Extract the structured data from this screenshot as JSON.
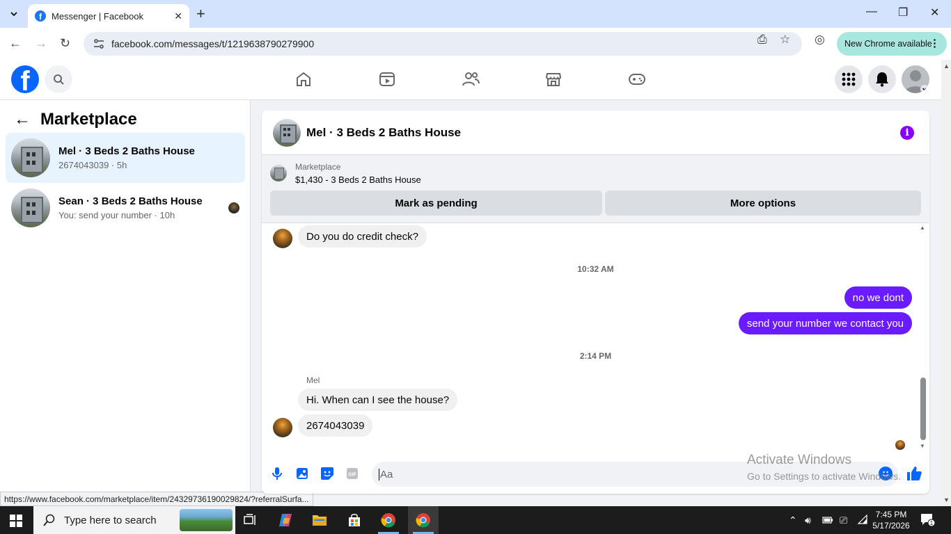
{
  "browser": {
    "tab_title": "Messenger | Facebook",
    "url": "facebook.com/messages/t/1219638790279900",
    "new_chrome_label": "New Chrome available",
    "status_url": "https://www.facebook.com/marketplace/item/24329736190029824/?referralSurfa..."
  },
  "sidebar": {
    "title": "Marketplace",
    "conversations": [
      {
        "name": "Mel · 3 Beds 2 Baths House",
        "subtitle": "2674043039 · 5h",
        "active": true
      },
      {
        "name": "Sean · 3 Beds 2 Baths House",
        "subtitle": "You: send your number · 10h",
        "active": false
      }
    ]
  },
  "chat": {
    "title": "Mel · 3 Beds 2 Baths House",
    "listing": {
      "label": "Marketplace",
      "price_title": "$1,430 - 3 Beds 2 Baths House",
      "mark_pending": "Mark as pending",
      "more_options": "More options"
    },
    "messages": {
      "m1": "Do you do credit check?",
      "time1": "10:32 AM",
      "m2": "no we dont",
      "m3": "send your number we contact you",
      "time2": "2:14 PM",
      "sender": "Mel",
      "m4": "Hi. When can I see the house?",
      "m5": "2674043039"
    },
    "composer_placeholder": "Aa"
  },
  "watermark": {
    "line1": "Activate Windows",
    "line2": "Go to Settings to activate Windows."
  },
  "taskbar": {
    "search_placeholder": "Type here to search",
    "time": "7:45 PM",
    "date": "5/17/2026",
    "notif_count": "1"
  },
  "colors": {
    "fb_blue": "#0866ff",
    "messenger_purple": "#6a1bff",
    "active_conv_bg": "#e7f3ff"
  }
}
